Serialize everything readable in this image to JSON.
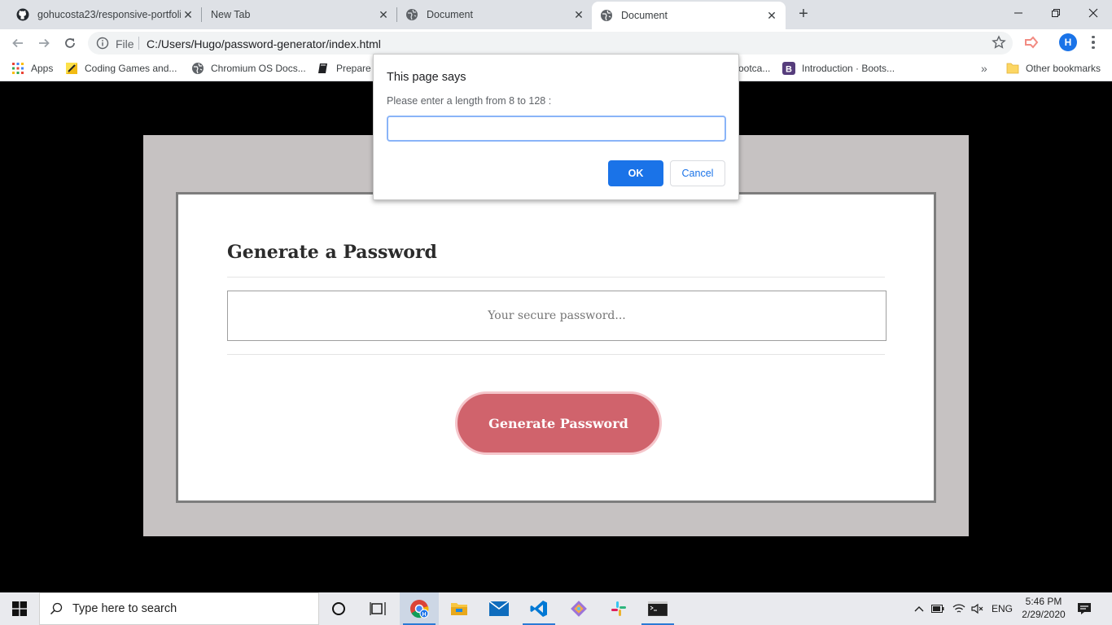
{
  "browser": {
    "tabs": [
      {
        "title": "gohucosta23/responsive-portfoli",
        "icon": "github-icon",
        "active": false
      },
      {
        "title": "New Tab",
        "icon": "none",
        "active": false
      },
      {
        "title": "Document",
        "icon": "globe-icon",
        "active": false
      },
      {
        "title": "Document",
        "icon": "globe-icon",
        "active": true
      }
    ],
    "new_tab_label": "+",
    "address": {
      "scheme_label": "File",
      "url": "C:/Users/Hugo/password-generator/index.html"
    },
    "profile_initial": "H"
  },
  "bookmarks": {
    "items": [
      {
        "label": "Apps",
        "icon": "apps-grid-icon"
      },
      {
        "label": "Coding Games and...",
        "icon": "codingame-icon"
      },
      {
        "label": "Chromium OS Docs...",
        "icon": "globe-icon"
      },
      {
        "label": "Prepare f",
        "icon": "book-icon"
      },
      {
        "label": "ootca...",
        "icon": "none"
      },
      {
        "label": "Introduction · Boots...",
        "icon": "bootstrap-icon"
      }
    ],
    "overflow_label": "»",
    "other_label": "Other bookmarks"
  },
  "page": {
    "title": "Generate a Password",
    "password_placeholder": "Your secure password...",
    "generate_button": "Generate Password",
    "colors": {
      "button": "#d0636c",
      "frame": "#c6c2c2",
      "background": "#000000"
    }
  },
  "dialog": {
    "title": "This page says",
    "message": "Please enter a length from 8 to 128 :",
    "input_value": "",
    "ok_label": "OK",
    "cancel_label": "Cancel"
  },
  "taskbar": {
    "search_placeholder": "Type here to search",
    "tray": {
      "language": "ENG"
    },
    "clock": {
      "time": "5:46 PM",
      "date": "2/29/2020"
    }
  }
}
